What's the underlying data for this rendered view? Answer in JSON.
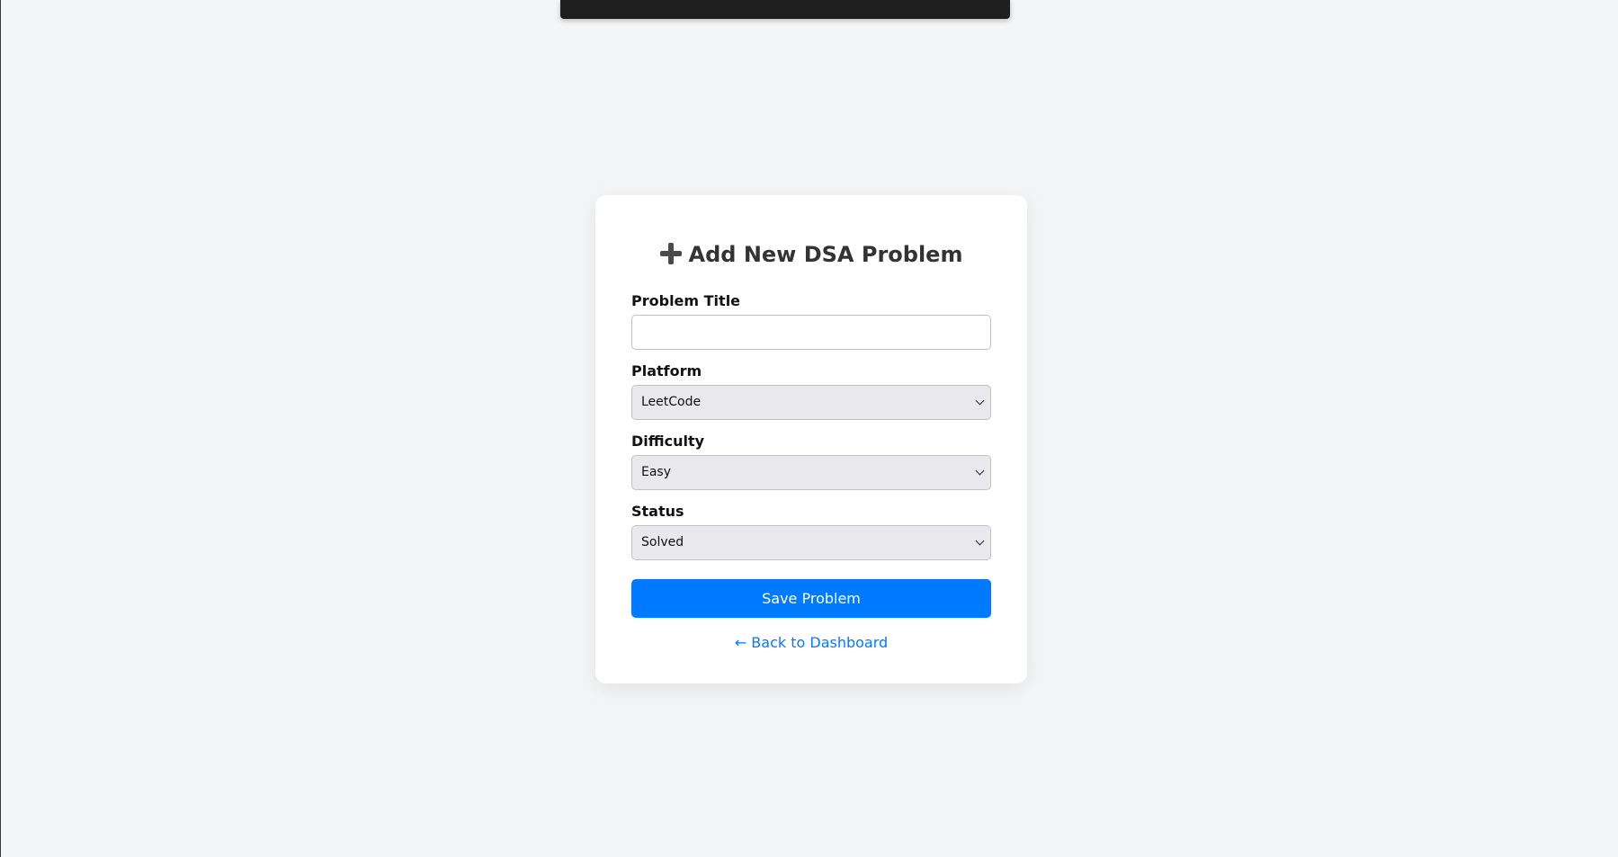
{
  "page": {
    "heading": "Add New DSA Problem",
    "heading_icon": "plus-icon"
  },
  "form": {
    "title_label": "Problem Title",
    "title_value": "",
    "title_placeholder": "",
    "platform_label": "Platform",
    "platform_value": "LeetCode",
    "difficulty_label": "Difficulty",
    "difficulty_value": "Easy",
    "status_label": "Status",
    "status_value": "Solved",
    "save_label": "Save Problem",
    "back_label": "← Back to Dashboard"
  },
  "colors": {
    "accent": "#007bff",
    "background": "#f4f5f7",
    "card": "#ffffff",
    "top_bar": "#1e1e1e"
  }
}
